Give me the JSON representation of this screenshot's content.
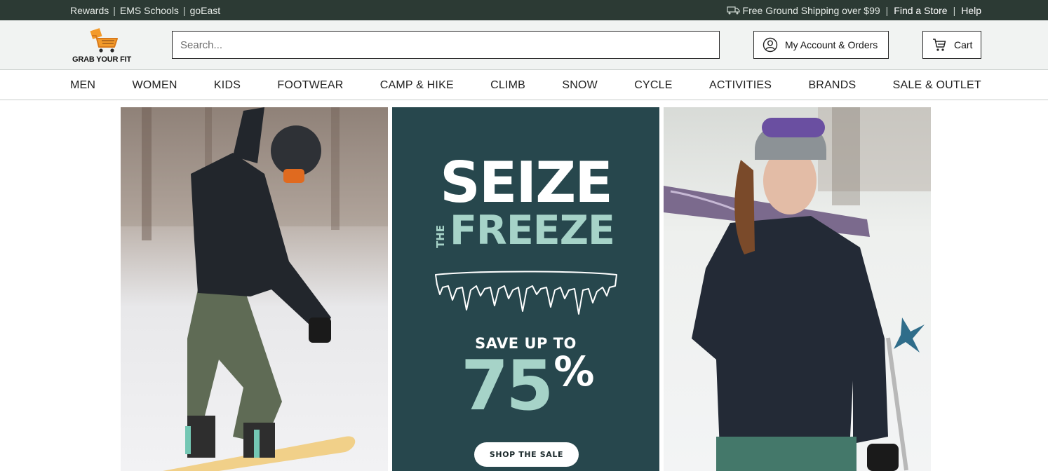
{
  "topbar": {
    "links_left": [
      "Rewards",
      "EMS Schools",
      "goEast"
    ],
    "separator": "|",
    "shipping_text": "Free Ground Shipping over $99",
    "find_store": "Find a Store",
    "help": "Help",
    "shipping_icon": "truck-icon"
  },
  "header": {
    "logo_text": "GRAB YOUR FIT",
    "logo_icon": "shopping-cart-icon",
    "search_placeholder": "Search...",
    "account_label": "My Account & Orders",
    "account_icon": "user-circle-icon",
    "cart_label": "Cart",
    "cart_icon": "cart-icon"
  },
  "nav": {
    "items": [
      "MEN",
      "WOMEN",
      "KIDS",
      "FOOTWEAR",
      "CAMP & HIKE",
      "CLIMB",
      "SNOW",
      "CYCLE",
      "ACTIVITIES",
      "BRANDS",
      "SALE & OUTLET"
    ]
  },
  "hero": {
    "headline_1": "SEIZE",
    "headline_small": "THE",
    "headline_2": "FREEZE",
    "save_text": "SAVE UP TO",
    "percent_value": "75",
    "percent_sign": "%",
    "cta": "SHOP THE SALE",
    "colors": {
      "panel_bg": "#27474d",
      "accent_mint": "#a6d3c8",
      "topbar_bg": "#2c3a34",
      "logo_orange": "#f39a2a"
    }
  }
}
